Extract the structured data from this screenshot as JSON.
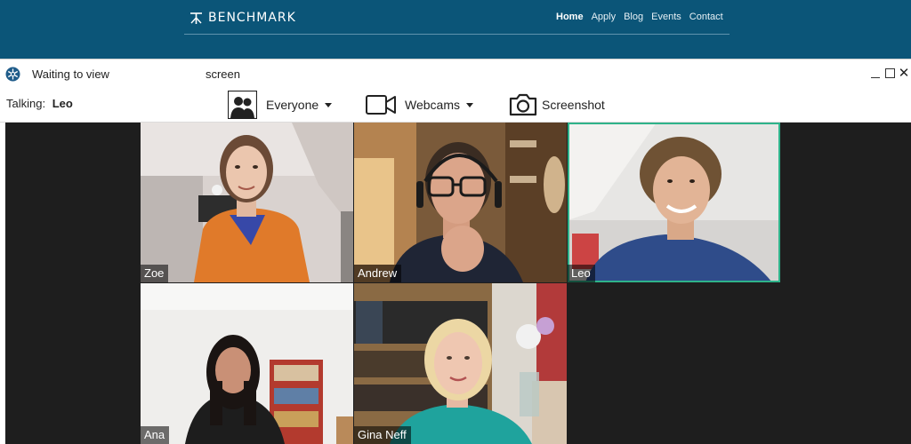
{
  "site": {
    "brand": "BENCHMARK",
    "nav": [
      {
        "label": "Home",
        "active": true
      },
      {
        "label": "Apply",
        "active": false
      },
      {
        "label": "Blog",
        "active": false
      },
      {
        "label": "Events",
        "active": false
      },
      {
        "label": "Contact",
        "active": false
      }
    ],
    "colors": {
      "header_bg": "#0b5578"
    }
  },
  "viewer": {
    "title_prefix": "Waiting to view",
    "title_suffix": "screen",
    "app_icon": "snowflake-icon",
    "window_controls": [
      "minimize-icon",
      "maximize-icon",
      "close-icon"
    ],
    "talking_label": "Talking:",
    "talking_name": "Leo",
    "toolbar": {
      "everyone_label": "Everyone",
      "webcams_label": "Webcams",
      "screenshot_label": "Screenshot"
    },
    "participants": [
      {
        "name": "Zoe",
        "active": false
      },
      {
        "name": "Andrew",
        "active": false
      },
      {
        "name": "Leo",
        "active": true
      },
      {
        "name": "Ana",
        "active": false
      },
      {
        "name": "Gina Neff",
        "active": false
      }
    ],
    "colors": {
      "active_border": "#2fb38a",
      "stage_bg": "#1e1e1e"
    }
  }
}
